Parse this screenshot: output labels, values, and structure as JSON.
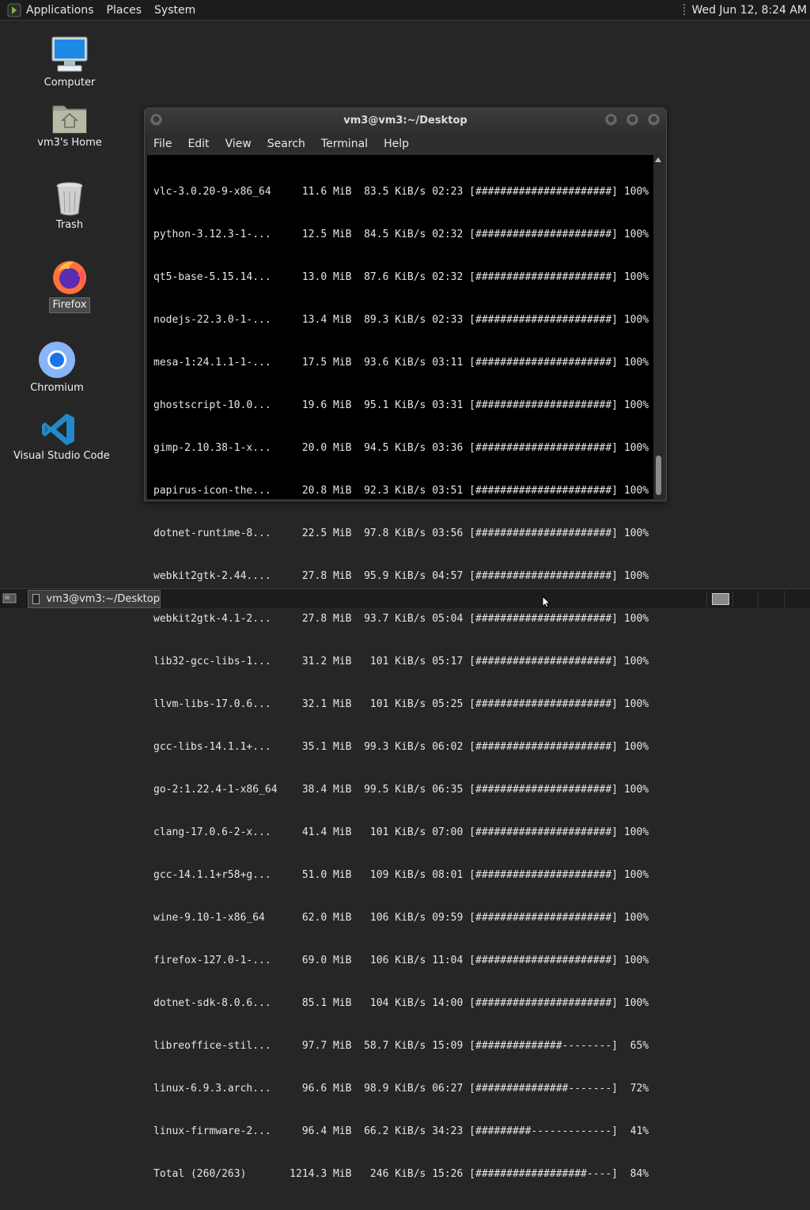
{
  "top_panel": {
    "menus": [
      "Applications",
      "Places",
      "System"
    ],
    "clock": "Wed Jun 12,  8:24 AM"
  },
  "desktop_icons": {
    "computer": "Computer",
    "home": "vm3's Home",
    "trash": "Trash",
    "firefox": "Firefox",
    "chromium": "Chromium",
    "vscode": "Visual Studio Code"
  },
  "terminal": {
    "title": "vm3@vm3:~/Desktop",
    "menus": [
      "File",
      "Edit",
      "View",
      "Search",
      "Terminal",
      "Help"
    ],
    "lines": [
      "vlc-3.0.20-9-x86_64     11.6 MiB  83.5 KiB/s 02:23 [######################] 100%",
      "python-3.12.3-1-...     12.5 MiB  84.5 KiB/s 02:32 [######################] 100%",
      "qt5-base-5.15.14...     13.0 MiB  87.6 KiB/s 02:32 [######################] 100%",
      "nodejs-22.3.0-1-...     13.4 MiB  89.3 KiB/s 02:33 [######################] 100%",
      "mesa-1:24.1.1-1-...     17.5 MiB  93.6 KiB/s 03:11 [######################] 100%",
      "ghostscript-10.0...     19.6 MiB  95.1 KiB/s 03:31 [######################] 100%",
      "gimp-2.10.38-1-x...     20.0 MiB  94.5 KiB/s 03:36 [######################] 100%",
      "papirus-icon-the...     20.8 MiB  92.3 KiB/s 03:51 [######################] 100%",
      "dotnet-runtime-8...     22.5 MiB  97.8 KiB/s 03:56 [######################] 100%",
      "webkit2gtk-2.44....     27.8 MiB  95.9 KiB/s 04:57 [######################] 100%",
      "webkit2gtk-4.1-2...     27.8 MiB  93.7 KiB/s 05:04 [######################] 100%",
      "lib32-gcc-libs-1...     31.2 MiB   101 KiB/s 05:17 [######################] 100%",
      "llvm-libs-17.0.6...     32.1 MiB   101 KiB/s 05:25 [######################] 100%",
      "gcc-libs-14.1.1+...     35.1 MiB  99.3 KiB/s 06:02 [######################] 100%",
      "go-2:1.22.4-1-x86_64    38.4 MiB  99.5 KiB/s 06:35 [######################] 100%",
      "clang-17.0.6-2-x...     41.4 MiB   101 KiB/s 07:00 [######################] 100%",
      "gcc-14.1.1+r58+g...     51.0 MiB   109 KiB/s 08:01 [######################] 100%",
      "wine-9.10-1-x86_64      62.0 MiB   106 KiB/s 09:59 [######################] 100%",
      "firefox-127.0-1-...     69.0 MiB   106 KiB/s 11:04 [######################] 100%",
      "dotnet-sdk-8.0.6...     85.1 MiB   104 KiB/s 14:00 [######################] 100%",
      "libreoffice-stil...     97.7 MiB  58.7 KiB/s 15:09 [##############--------]  65%",
      "linux-6.9.3.arch...     96.6 MiB  98.9 KiB/s 06:27 [###############-------]  72%",
      "linux-firmware-2...     96.4 MiB  66.2 KiB/s 34:23 [#########-------------]  41%",
      "Total (260/263)       1214.3 MiB   246 KiB/s 15:26 [##################----]  84%"
    ]
  },
  "bottom_panel": {
    "taskbar_label": "vm3@vm3:~/Desktop"
  }
}
